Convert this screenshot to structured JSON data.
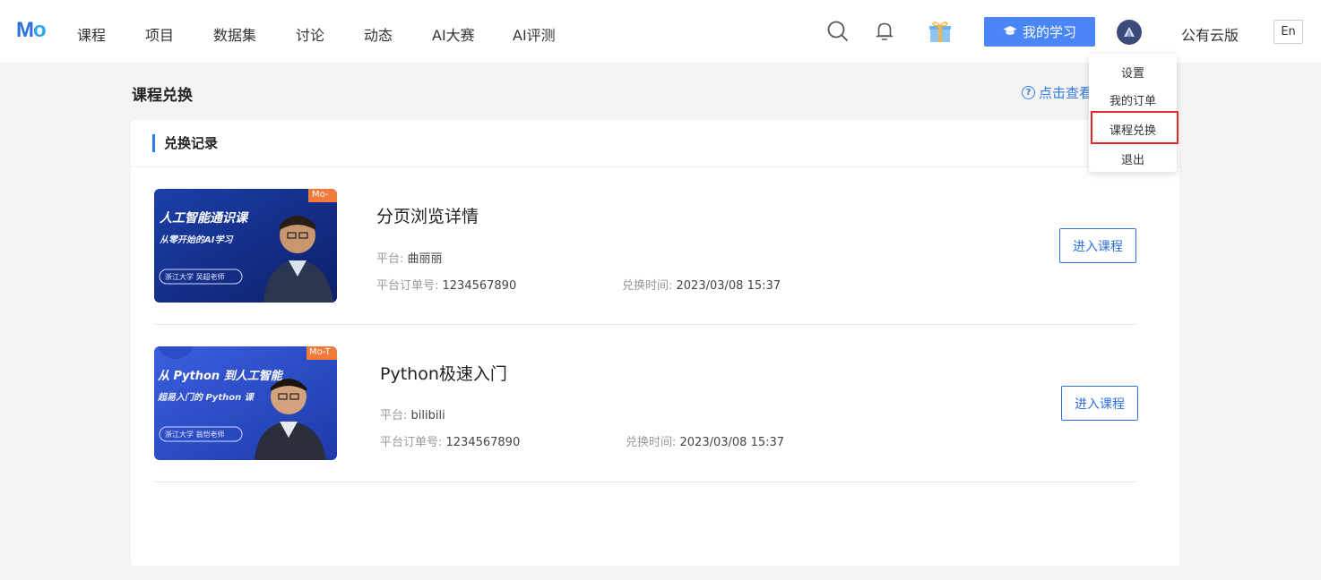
{
  "nav": {
    "logo": {
      "m": "M",
      "o": "o"
    },
    "items": [
      "课程",
      "项目",
      "数据集",
      "讨论",
      "动态",
      "AI大赛",
      "AI评测"
    ],
    "my_study_label": "我的学习",
    "cloud_label": "公有云版",
    "lang_label": "En",
    "icons": [
      "search-icon",
      "bell-icon",
      "gift-icon",
      "graduation-cap-icon",
      "avatar-icon"
    ]
  },
  "page": {
    "title": "课程兑换",
    "help_text": "点击查看",
    "help_icon_glyph": "?",
    "section_title": "兑换记录"
  },
  "labels": {
    "platform": "平台: ",
    "order": "平台订单号: ",
    "time": "兑换时间: ",
    "enter": "进入课程"
  },
  "courses": [
    {
      "name": "分页浏览详情",
      "platform": "曲丽丽",
      "order_no": "1234567890",
      "redeem_time": "2023/03/08 15:37",
      "thumb": {
        "title": "人工智能通识课",
        "subtitle": "从零开始的AI学习",
        "teacher": "浙江大学 吴超老师",
        "tag": "Mo-"
      }
    },
    {
      "name": "Python极速入门",
      "platform": "bilibili",
      "order_no": "1234567890",
      "redeem_time": "2023/03/08 15:37",
      "thumb": {
        "title": "从 Python 到人工智能",
        "subtitle": "超易入门的 Python 课",
        "teacher": "浙江大学 翁恺老师",
        "tag": "Mo-T"
      }
    }
  ],
  "dropdown": {
    "items": [
      "设置",
      "我的订单",
      "课程兑换",
      "退出"
    ],
    "selected": "课程兑换"
  },
  "colors": {
    "accent": "#2f7ae5",
    "button": "#4a86f7",
    "highlight": "#e02b2b"
  }
}
